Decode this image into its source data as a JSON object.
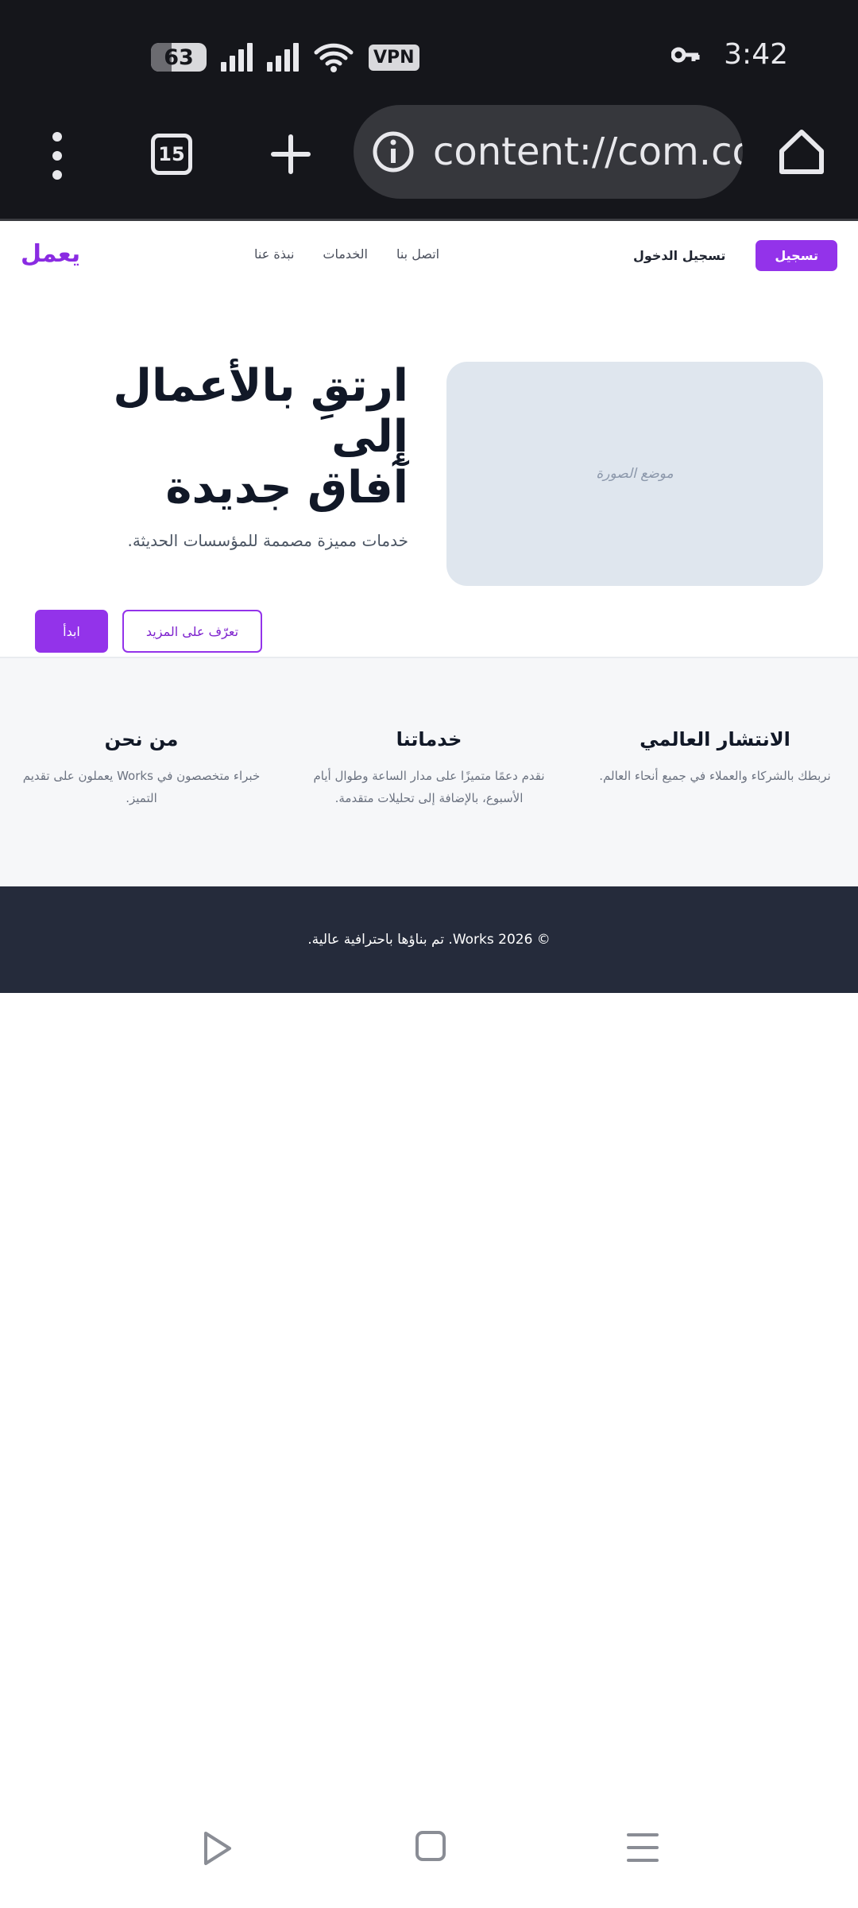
{
  "status_bar": {
    "battery": "63",
    "vpn": "VPN",
    "time": "3:42",
    "icons": [
      "battery-icon",
      "signal-icon",
      "signal-icon",
      "wifi-icon",
      "vpn-icon",
      "key-icon"
    ]
  },
  "browser": {
    "tab_count": "15",
    "url": "content://com.col",
    "icons": [
      "menu-dots-icon",
      "tabs-icon",
      "plus-icon",
      "info-icon",
      "home-icon"
    ]
  },
  "page": {
    "brand": "يعمل",
    "nav": {
      "links": [
        "نبذة عنا",
        "الخدمات",
        "اتصل بنا"
      ],
      "login": "تسجيل الدخول",
      "register": "تسجيل"
    },
    "hero": {
      "title_line1": "ارتقِ بالأعمال إلى",
      "title_line2": "آفاق جديدة",
      "subtitle": "خدمات مميزة مصممة للمؤسسات الحديثة.",
      "image_placeholder": "موضع الصورة",
      "primary_button": "ابدأ",
      "secondary_button": "تعرّف على المزيد"
    },
    "features": [
      {
        "title": "الانتشار العالمي",
        "text": "نربطك بالشركاء والعملاء في جميع أنحاء العالم."
      },
      {
        "title": "خدماتنا",
        "text": "نقدم دعمًا متميزًا على مدار الساعة وطوال أيام الأسبوع، بالإضافة إلى تحليلات متقدمة."
      },
      {
        "title": "من نحن",
        "text": "خبراء متخصصون في Works يعملون على تقديم التميز."
      }
    ],
    "footer": "© 2026 Works. تم بناؤها باحترافية عالية."
  },
  "system_nav": {
    "icons": [
      "back-icon",
      "home-icon",
      "recents-icon"
    ]
  },
  "colors": {
    "accent": "#9333ea",
    "status_bar": "#15161b",
    "footer": "#252b3b",
    "features_bg": "#f6f7f9"
  }
}
